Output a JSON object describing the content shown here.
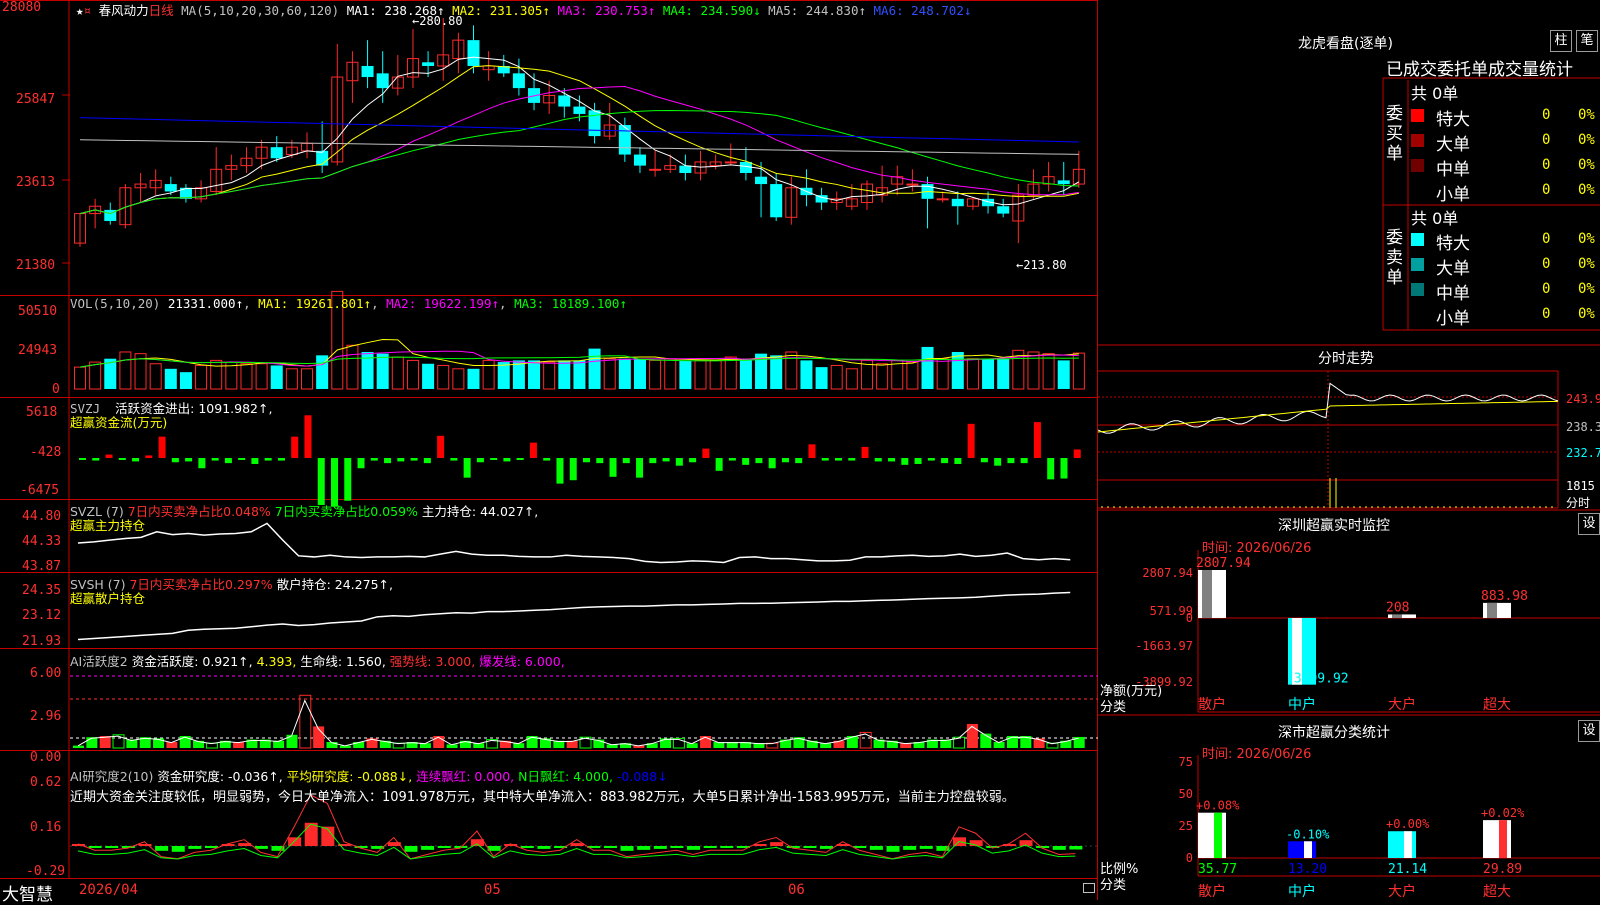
{
  "colors": {
    "up": "#ff2a2a",
    "down": "#00ffff",
    "grid": "#c40000",
    "axis_text": "#ff3030",
    "ma1": "#ffffff",
    "ma2": "#ffff00",
    "ma3": "#ff00ff",
    "ma4": "#00ff00",
    "ma5": "#c0c0c0",
    "ma6": "#0000ff",
    "inflow": "#ff0000",
    "outflow": "#00ff00"
  },
  "icons": {
    "star": "star-icon",
    "flag": "flag-icon"
  },
  "main": {
    "stock_name": "春风动力",
    "period": "日线",
    "legend": [
      {
        "text": "MA(5,10,20,30,60,120)",
        "color": "#c0c0c0"
      },
      {
        "text": "MA1: 238.268↑",
        "color": "#ffffff"
      },
      {
        "text": "MA2: 231.305↑",
        "color": "#ffff00"
      },
      {
        "text": "MA3: 230.753↑",
        "color": "#ff00ff"
      },
      {
        "text": "MA4: 234.590↓",
        "color": "#00ff00"
      },
      {
        "text": "MA5: 244.830↑",
        "color": "#c0c0c0"
      },
      {
        "text": "MA6: 248.702↓",
        "color": "#3050ff"
      }
    ],
    "yticks": [
      "28080",
      "25847",
      "23613",
      "21380"
    ],
    "high_mark": "280.80",
    "low_mark": "213.80"
  },
  "vol": {
    "label": "VOL(5,10,20)",
    "value": "21331.000↑",
    "ma1": "MA1: 19261.801↑",
    "ma2": "MA2: 19622.199↑",
    "ma3": "MA3: 18189.100↑",
    "yticks": [
      "50510",
      "24943",
      "0"
    ]
  },
  "svzj": {
    "label": "SVZJ",
    "item": "活跃资金进出: 1091.982↑,",
    "subtitle": "超赢资金流(万元)",
    "yticks": [
      "5618",
      "-428",
      "-6475"
    ]
  },
  "svzl": {
    "label": "SVZL (7)",
    "item1": "7日内买卖净占比0.048%",
    "item2": "7日内买卖净占比0.059%",
    "item3": "主力持仓: 44.027↑,",
    "subtitle": "超赢主力持仓",
    "yticks": [
      "44.80",
      "44.33",
      "43.87"
    ]
  },
  "svsh": {
    "label": "SVSH (7)",
    "item1": "7日内买卖净占比0.297%",
    "item2": "散户持仓: 24.275↑,",
    "subtitle": "超赢散户持仓",
    "yticks": [
      "24.35",
      "23.12",
      "21.93"
    ]
  },
  "ai1": {
    "label": "AI活跃度2",
    "item1": "资金活跃度: 0.921↑,",
    "item2": "4.393,",
    "item3": "生命线: 1.560,",
    "item4": "强势线: 3.000,",
    "item5": "爆发线: 6.000,",
    "yticks": [
      "6.00",
      "2.96",
      "0.00"
    ]
  },
  "ai2": {
    "label": "AI研究度2(10)",
    "item1": "资金研究度: -0.036↑,",
    "item2": "平均研究度: -0.088↓,",
    "item3": "连续飘红: 0.000,",
    "item4": "N日飘红: 4.000,",
    "item5": "-0.088↓",
    "note": "近期大资金关注度较低，明显弱势，今日大单净流入：1091.978万元，其中特大单净流入：883.982万元，大单5日累计净出-1583.995万元，当前主力控盘较弱。",
    "yticks": [
      "0.62",
      "0.16",
      "-0.29"
    ]
  },
  "xaxis": {
    "labels": [
      "2026/04",
      "05",
      "06"
    ]
  },
  "brand": "大智慧",
  "right": {
    "longhu": {
      "title": "龙虎看盘(逐单)",
      "btn1": "柱",
      "btn2": "笔",
      "header": "已成交委托单成交量统计",
      "buy": {
        "side": "委买单",
        "total": "共 0单",
        "rows": [
          {
            "label": "特大",
            "count": "0",
            "pct": "0%",
            "color": "#ff0000"
          },
          {
            "label": "大单",
            "count": "0",
            "pct": "0%",
            "color": "#a00000"
          },
          {
            "label": "中单",
            "count": "0",
            "pct": "0%",
            "color": "#700000"
          },
          {
            "label": "小单",
            "count": "0",
            "pct": "0%",
            "color": ""
          }
        ]
      },
      "sell": {
        "side": "委卖单",
        "total": "共 0单",
        "rows": [
          {
            "label": "特大",
            "count": "0",
            "pct": "0%",
            "color": "#00ffff"
          },
          {
            "label": "大单",
            "count": "0",
            "pct": "0%",
            "color": "#00a0a0"
          },
          {
            "label": "中单",
            "count": "0",
            "pct": "0%",
            "color": "#007878"
          },
          {
            "label": "小单",
            "count": "0",
            "pct": "0%",
            "color": ""
          }
        ]
      }
    },
    "fenshi": {
      "title": "分时走势",
      "yticks": [
        "243.9",
        "238.3",
        "232.7",
        "1815"
      ],
      "unit": "分时"
    },
    "monitor": {
      "title": "深圳超赢实时监控",
      "btn": "设",
      "time": "时间: 2026/06/26",
      "yticks": [
        "2807.94",
        "571.99",
        "0",
        "-1663.97",
        "-3899.92"
      ],
      "ylabel1": "净额(万元)",
      "ylabel2": "分类",
      "cats": [
        "散户",
        "中户",
        "大户",
        "超大"
      ],
      "vals": [
        "2807.94",
        "-3899.92",
        "208",
        "883.98"
      ]
    },
    "classify": {
      "title": "深市超赢分类统计",
      "btn": "设",
      "time": "时间: 2026/06/26",
      "yticks": [
        "75",
        "50",
        "25",
        "0"
      ],
      "ylabel1": "比例%",
      "ylabel2": "分类",
      "cats": [
        "散户",
        "中户",
        "大户",
        "超大"
      ],
      "top": [
        "+0.08%",
        "-0.10%",
        "+0.00%",
        "+0.02%"
      ],
      "bottom": [
        "35.77",
        "13.20",
        "21.14",
        "29.89"
      ]
    }
  },
  "chart_data": [
    {
      "type": "candlestick",
      "title": "春风动力 日线",
      "y_unit": "price ×100 axis",
      "ylim": [
        21380,
        28080
      ],
      "ohlc": [
        [
          220,
          228,
          219,
          228
        ],
        [
          228,
          230,
          224,
          232
        ],
        [
          229,
          226,
          225,
          231
        ],
        [
          225,
          235,
          224,
          236
        ],
        [
          235,
          236,
          231,
          239
        ],
        [
          235,
          237,
          233,
          240
        ],
        [
          236,
          234,
          233,
          238
        ],
        [
          235,
          232,
          231,
          236
        ],
        [
          232,
          235,
          231,
          237
        ],
        [
          234,
          240,
          233,
          246
        ],
        [
          240,
          241,
          237,
          244
        ],
        [
          241,
          243,
          239,
          246
        ],
        [
          243,
          246,
          240,
          248
        ],
        [
          246,
          243,
          242,
          249
        ],
        [
          244,
          246,
          243,
          248
        ],
        [
          245,
          247,
          243,
          250
        ],
        [
          245,
          241,
          239,
          253
        ],
        [
          242,
          265,
          241,
          274
        ],
        [
          264,
          269,
          258,
          272
        ],
        [
          268,
          265,
          262,
          275
        ],
        [
          266,
          262,
          258,
          272
        ],
        [
          262,
          265,
          260,
          271
        ],
        [
          265,
          270,
          262,
          278
        ],
        [
          269,
          268,
          265,
          272
        ],
        [
          268,
          271,
          264,
          281
        ],
        [
          270,
          275,
          266,
          277
        ],
        [
          275,
          268,
          266,
          279
        ],
        [
          267,
          268,
          264,
          272
        ],
        [
          268,
          266,
          265,
          271
        ],
        [
          266,
          262,
          260,
          270
        ],
        [
          262,
          258,
          256,
          266
        ],
        [
          258,
          260,
          255,
          264
        ],
        [
          260,
          257,
          254,
          262
        ],
        [
          257,
          255,
          253,
          260
        ],
        [
          256,
          249,
          247,
          258
        ],
        [
          249,
          252,
          248,
          258
        ],
        [
          252,
          244,
          242,
          254
        ],
        [
          244,
          241,
          239,
          246
        ],
        [
          240,
          240,
          238,
          245
        ],
        [
          240,
          241,
          239,
          244
        ],
        [
          241,
          239,
          237,
          244
        ],
        [
          239,
          242,
          237,
          245
        ],
        [
          241,
          242,
          240,
          244
        ],
        [
          242,
          242,
          241,
          247
        ],
        [
          242,
          239,
          237,
          246
        ],
        [
          238,
          236,
          227,
          242
        ],
        [
          236,
          227,
          226,
          239
        ],
        [
          227,
          235,
          225,
          238
        ],
        [
          235,
          233,
          230,
          240
        ],
        [
          233,
          231,
          229,
          235
        ],
        [
          231,
          232,
          229,
          234
        ],
        [
          230,
          232,
          229,
          236
        ],
        [
          231,
          236,
          229,
          237
        ],
        [
          233,
          235,
          231,
          241
        ],
        [
          236,
          238,
          233,
          241
        ],
        [
          236,
          236,
          234,
          240
        ],
        [
          236,
          232,
          224,
          238
        ],
        [
          232,
          232,
          231,
          234
        ],
        [
          232,
          230,
          225,
          234
        ],
        [
          230,
          232,
          229,
          232
        ],
        [
          232,
          230,
          228,
          234
        ],
        [
          230,
          228,
          227,
          232
        ],
        [
          226,
          233,
          220,
          236
        ],
        [
          233,
          236,
          232,
          240
        ],
        [
          236,
          238,
          234,
          242
        ],
        [
          237,
          236,
          233,
          242
        ],
        [
          236,
          240,
          235,
          245
        ]
      ]
    },
    {
      "type": "bar",
      "title": "VOL",
      "ylim": [
        0,
        50510
      ],
      "values": [
        13000,
        16000,
        18000,
        22000,
        21000,
        15000,
        12000,
        10000,
        14000,
        17000,
        16000,
        15000,
        15000,
        14000,
        12000,
        12000,
        20000,
        58000,
        26000,
        22000,
        21000,
        19000,
        17000,
        15000,
        14000,
        12000,
        12000,
        17000,
        16000,
        17000,
        17000,
        16000,
        17000,
        17000,
        24000,
        18000,
        18000,
        18000,
        17000,
        18000,
        17000,
        17000,
        17000,
        19000,
        18000,
        21000,
        20000,
        22000,
        17000,
        13000,
        14000,
        12000,
        17000,
        15000,
        17000,
        16000,
        25000,
        18000,
        22000,
        18000,
        18000,
        18000,
        23000,
        22000,
        21000,
        17000,
        21331
      ]
    },
    {
      "type": "bar",
      "title": "超赢资金流(万元)",
      "ylim": [
        -6475,
        5618
      ],
      "values": [
        -200,
        -300,
        400,
        -200,
        -400,
        300,
        2500,
        -500,
        -400,
        -1200,
        -300,
        -600,
        -200,
        -700,
        -300,
        -300,
        2500,
        5000,
        -5500,
        -5700,
        -5000,
        -1200,
        -300,
        -600,
        -400,
        -300,
        -600,
        2600,
        -300,
        -2300,
        -500,
        -200,
        -400,
        -200,
        1800,
        -300,
        -3000,
        -2600,
        -500,
        -600,
        -2200,
        -600,
        -2300,
        -600,
        -400,
        -900,
        -500,
        1100,
        -1500,
        -300,
        -800,
        -600,
        -1200,
        -500,
        -600,
        1600,
        -300,
        -300,
        -300,
        1300,
        -400,
        -400,
        -800,
        -700,
        -300,
        -600,
        -700,
        4000,
        -500,
        -900,
        -600,
        -600,
        4200,
        -2500,
        -2400,
        1000
      ]
    },
    {
      "type": "line",
      "title": "超赢主力持仓",
      "ylim": [
        43.87,
        44.8
      ],
      "values": [
        44.3,
        44.32,
        44.35,
        44.38,
        44.4,
        44.5,
        44.45,
        44.47,
        44.44,
        44.46,
        44.47,
        44.5,
        44.65,
        44.35,
        44.07,
        44.05,
        44.08,
        44.05,
        44.04,
        44.05,
        44.05,
        44.06,
        44.05,
        44.1,
        44.15,
        44.1,
        44.08,
        44.08,
        44.06,
        44.05,
        44.05,
        44.08,
        44.06,
        44.05,
        44.04,
        44.02,
        43.97,
        43.95,
        43.96,
        43.98,
        43.97,
        43.95,
        44.04,
        44.05,
        44.02,
        44.02,
        44.0,
        43.98,
        43.98,
        43.99,
        44.05,
        44.05,
        44.07,
        44.08,
        44.06,
        44.07,
        44.1,
        44.06,
        44.08,
        44.12,
        44.02,
        44.0,
        44.02,
        44.0
      ]
    },
    {
      "type": "line",
      "title": "超赢散户持仓",
      "ylim": [
        21.93,
        24.35
      ],
      "values": [
        22.0,
        22.05,
        22.1,
        22.15,
        22.2,
        22.25,
        22.3,
        22.45,
        22.5,
        22.52,
        22.55,
        22.62,
        22.7,
        22.75,
        22.68,
        22.72,
        22.8,
        22.85,
        22.9,
        23.1,
        23.15,
        23.12,
        23.2,
        23.25,
        23.3,
        23.28,
        23.35,
        23.35,
        23.38,
        23.42,
        23.45,
        23.5,
        23.55,
        23.58,
        23.6,
        23.62,
        23.62,
        23.65,
        23.68,
        23.68,
        23.7,
        23.72,
        23.75,
        23.75,
        23.76,
        23.78,
        23.8,
        23.82,
        23.85,
        23.85,
        23.88,
        23.9,
        23.92,
        23.95,
        23.98,
        24.0,
        24.02,
        24.05,
        24.1,
        24.15,
        24.18,
        24.2,
        24.25,
        24.275
      ]
    },
    {
      "type": "bar",
      "title": "AI活跃度2",
      "ylim": [
        0,
        6
      ],
      "values": [
        0.2,
        0.9,
        1.0,
        1.1,
        0.7,
        0.9,
        0.8,
        0.5,
        1.0,
        0.6,
        0.4,
        0.6,
        0.5,
        0.7,
        0.7,
        0.6,
        1.1,
        4.393,
        1.8,
        0.5,
        0.2,
        0.5,
        0.8,
        0.6,
        0.4,
        0.5,
        0.4,
        1.0,
        0.3,
        0.6,
        0.4,
        0.7,
        0.6,
        0.4,
        1.0,
        0.8,
        0.6,
        0.6,
        0.9,
        0.7,
        0.3,
        0.4,
        0.2,
        0.4,
        0.8,
        0.8,
        0.4,
        1.0,
        0.5,
        0.5,
        0.5,
        0.4,
        0.4,
        0.7,
        0.9,
        0.6,
        0.4,
        0.6,
        1.0,
        1.3,
        0.7,
        0.6,
        0.4,
        0.5,
        0.7,
        0.7,
        0.9,
        2.0,
        1.2,
        0.5,
        1.0,
        1.0,
        0.8,
        0.4,
        0.6,
        0.921
      ]
    },
    {
      "type": "bar",
      "title": "AI研究度2(10)",
      "ylim": [
        -0.29,
        0.62
      ],
      "values": [
        0.01,
        -0.02,
        -0.02,
        -0.01,
        0.02,
        -0.05,
        -0.06,
        -0.03,
        -0.02,
        0.01,
        0.03,
        -0.03,
        -0.05,
        0.09,
        0.24,
        0.2,
        0.02,
        -0.01,
        -0.03,
        0.04,
        -0.06,
        -0.04,
        -0.02,
        -0.01,
        0.07,
        -0.05,
        0.01,
        -0.02,
        -0.03,
        -0.02,
        0.03,
        -0.02,
        -0.02,
        -0.05,
        -0.04,
        -0.03,
        -0.02,
        -0.04,
        -0.02,
        -0.02,
        -0.02,
        0.02,
        0.04,
        -0.01,
        -0.02,
        -0.03,
        0.02,
        -0.02,
        -0.04,
        -0.06,
        -0.04,
        -0.03,
        -0.05,
        0.09,
        0.06,
        -0.01,
        0.01,
        0.06,
        -0.01,
        -0.04,
        -0.036
      ]
    }
  ]
}
